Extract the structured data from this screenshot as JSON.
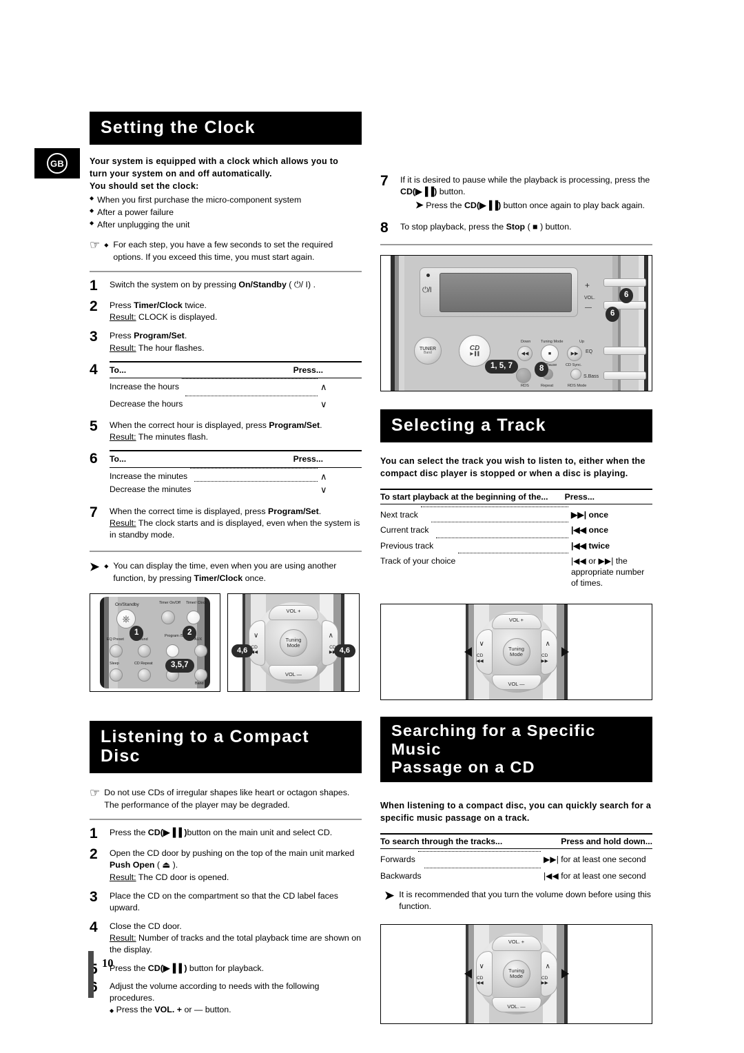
{
  "page": {
    "number": "10",
    "locale_badge": "GB"
  },
  "left": {
    "section1": {
      "title": "Setting the Clock",
      "intro_lines": [
        "Your system is equipped with a clock which allows you to",
        "turn your system on and off automatically.",
        "You should set the clock:"
      ],
      "bullets": [
        "When you first purchase the micro-component system",
        "After a power failure",
        "After unplugging the unit"
      ],
      "hand_note": "For each step, you have a few seconds to set the required options. If you exceed this time, you must start again.",
      "steps": [
        {
          "num": "1",
          "text": "Switch the system on by pressing ",
          "bold": "On/Standby",
          "after": " ( ⏻/ I) ."
        },
        {
          "num": "2",
          "text": "Press ",
          "bold": "Timer/Clock",
          "after": " twice.",
          "result_label": "Result:",
          "result": " CLOCK is displayed."
        },
        {
          "num": "3",
          "text": "Press ",
          "bold": "Program/Set",
          "after": ".",
          "result_label": "Result:",
          "result": " The hour flashes."
        },
        {
          "num": "5",
          "text": "When the correct hour is displayed, press ",
          "bold": "Program/Set",
          "after": ".",
          "result_label": "Result:",
          "result": " The minutes flash."
        },
        {
          "num": "7",
          "text": "When the correct time is displayed, press ",
          "bold": "Program/Set",
          "after": ".",
          "result_label": "Result:",
          "result": " The clock starts and is displayed, even when the system is in standby mode."
        }
      ],
      "table4": {
        "num": "4",
        "col1": "To...",
        "col2": "Press...",
        "rows": [
          {
            "label": "Increase the hours",
            "value": "∧"
          },
          {
            "label": "Decrease the hours",
            "value": "∨"
          }
        ]
      },
      "table6": {
        "num": "6",
        "col1": "To...",
        "col2": "Press...",
        "rows": [
          {
            "label": "Increase the minutes",
            "value": "∧"
          },
          {
            "label": "Decrease the minutes",
            "value": "∨"
          }
        ]
      },
      "arrow_note": "You can display the time, even when you are using another function, by pressing ",
      "arrow_note_bold": "Timer/Clock",
      "arrow_note_tail": " once."
    },
    "remote_fig": {
      "buttons": [
        "On/Standby",
        "Timer On/Off",
        "Timer/ Clock",
        "EQ Preset",
        "Sound",
        "Program /Set",
        "AUX",
        "Sleep",
        "CD Repeat",
        "Mo",
        "Band"
      ],
      "callouts": [
        "1",
        "2",
        "3,5,7"
      ]
    },
    "nav_fig": {
      "vol_up": "VOL +",
      "vol_down": "VOL —",
      "hub": "Tuning Mode",
      "cd_left": "CD",
      "cd_right": "CD",
      "callout_left": "4,6",
      "callout_right": "4,6",
      "caret_left": "∨",
      "caret_right": "∧"
    },
    "section2": {
      "title": "Listening to a Compact Disc",
      "hand_note": "Do not use CDs of irregular shapes like heart or octagon shapes. The performance of the player may be degraded.",
      "steps": [
        {
          "num": "1",
          "pre": "Press the ",
          "bold": "CD(▶▐▐ )",
          "post": "button on the main unit and select CD."
        },
        {
          "num": "2",
          "pre": "Open the CD door by pushing on the top of the main unit marked ",
          "bold2": "Push Open",
          "post2": " ( ⏏ ).",
          "result_label": "Result:",
          "result": " The CD door is opened."
        },
        {
          "num": "3",
          "pre": "Place the CD on the compartment so that the CD label faces upward."
        },
        {
          "num": "4",
          "pre": "Close the CD door.",
          "result_label": "Result:",
          "result": " Number of tracks and the total playback time are shown on the display."
        },
        {
          "num": "5",
          "pre": "Press the ",
          "bold": "CD(▶▐▐ )",
          "post": " button for playback."
        },
        {
          "num": "6",
          "pre": "Adjust the volume according to needs with the following procedures.",
          "sub": "Press the ",
          "sub_bold": "VOL. +",
          "sub_post": " or — button."
        }
      ]
    }
  },
  "right": {
    "top_steps": [
      {
        "num": "7",
        "pre": "If it is desired to pause while the playback is processing, press the ",
        "bold": "CD(▶▐▐)",
        "post": " button.",
        "note_pre": "Press the ",
        "note_bold": "CD(▶▐▐)",
        "note_post": " button once again to play back again."
      },
      {
        "num": "8",
        "pre": "To stop playback, press the ",
        "bold": "Stop",
        "post": " ( ■ ) button."
      }
    ],
    "unit_fig": {
      "power": "⏻/I",
      "tuner": "TUNER",
      "tuner_sub": "Band",
      "cd": "CD",
      "cd_sub": "▶▐▐",
      "tuning_mode": "Tuning Mode",
      "down": "Down",
      "up": "Up",
      "vol": "VOL.",
      "plus": "+",
      "minus": "—",
      "eq": "EQ",
      "sbass": "S.Bass",
      "pause": "/Pause",
      "cd_sync": "CD Sync.",
      "rds": "RDS",
      "repeat": "Repeat",
      "rds_mode": "RDS Mode",
      "callouts": [
        "6",
        "6",
        "1, 5, 7",
        "8"
      ]
    },
    "section3": {
      "title": "Selecting a Track",
      "intro_lines": [
        "You can select the track you wish to listen to, either when the",
        "compact disc player is stopped or when a disc is playing."
      ],
      "table": {
        "col1": "To start playback at the beginning of the...",
        "col2": "Press...",
        "rows": [
          {
            "label": "Next track",
            "value": "▶▶|  once"
          },
          {
            "label": "Current track",
            "value": "|◀◀  once"
          },
          {
            "label": "Previous track",
            "value": "|◀◀  twice"
          },
          {
            "label": "Track of your choice",
            "value": "|◀◀  or  ▶▶| the appropriate number of times."
          }
        ]
      }
    },
    "nav_fig": {
      "vol_up": "VOL +",
      "vol_down": "VOL —",
      "hub": "Tuning Mode",
      "cd_left": "CD",
      "cd_right": "CD",
      "caret_left": "∨",
      "caret_right": "∧"
    },
    "section4": {
      "title_line1": "Searching for a Specific Music",
      "title_line2": "Passage on a CD",
      "intro_lines": [
        "When listening to a compact disc, you can quickly search for a",
        "specific music passage on a track."
      ],
      "table": {
        "col1": "To search through the tracks...",
        "col2": "Press and hold down...",
        "rows": [
          {
            "label": "Forwards",
            "value": "▶▶|  for at least one second"
          },
          {
            "label": "Backwards",
            "value": "|◀◀  for at least one second"
          }
        ]
      },
      "arrow_note": "It is recommended that you turn the volume down before using this function."
    },
    "nav_fig2": {
      "vol_up": "VOL. +",
      "vol_down": "VOL. —",
      "hub": "Tuning Mode",
      "cd_left": "CD",
      "cd_right": "CD",
      "caret_left": "∨",
      "caret_right": "∧"
    }
  }
}
